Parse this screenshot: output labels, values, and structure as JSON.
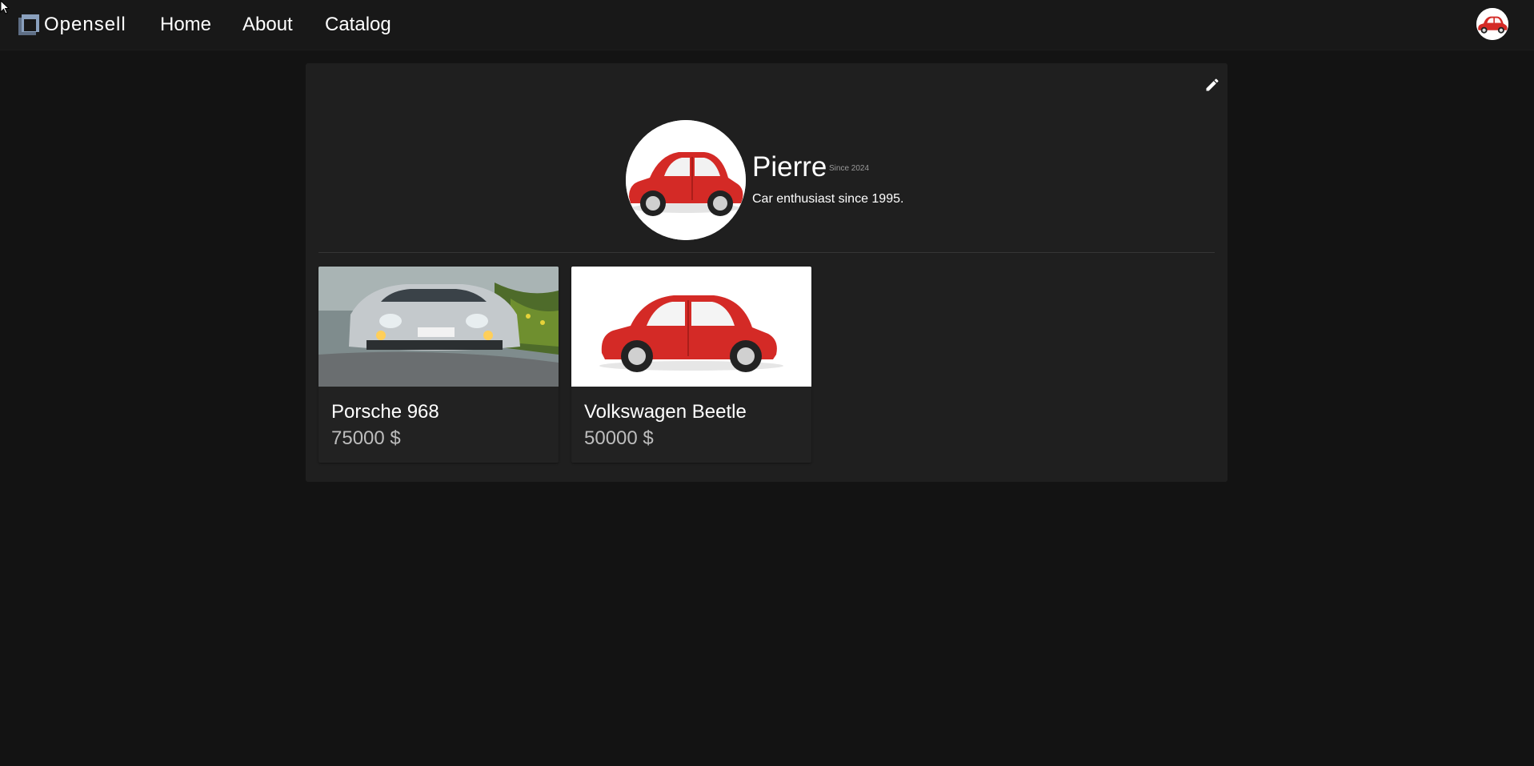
{
  "nav": {
    "brand": "Opensell",
    "links": [
      "Home",
      "About",
      "Catalog"
    ]
  },
  "profile": {
    "name": "Pierre",
    "since": "Since 2024",
    "bio": "Car enthusiast since 1995."
  },
  "listings": [
    {
      "title": "Porsche 968",
      "price": "75000 $"
    },
    {
      "title": "Volkswagen Beetle",
      "price": "50000 $"
    }
  ],
  "icons": {
    "logo": "opensell-logo-icon",
    "edit": "pencil-icon"
  },
  "colors": {
    "background": "#131313",
    "navbar": "#181818",
    "panel": "#1f1f1f",
    "card": "#222222",
    "price": "#bdbdbd",
    "car_red": "#d42a26"
  }
}
